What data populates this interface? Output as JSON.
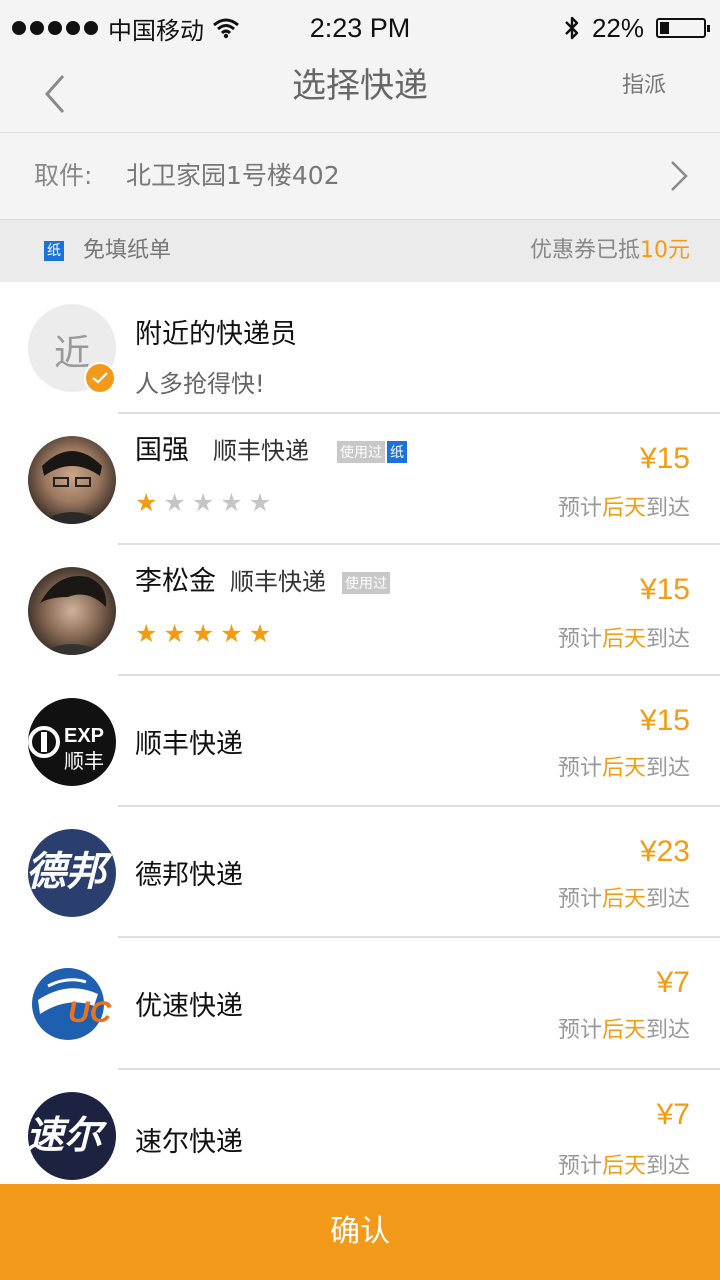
{
  "status_bar": {
    "carrier": "中国移动",
    "time": "2:23 PM",
    "battery": "22%",
    "battery_level": 0.22
  },
  "nav": {
    "back_icon": "chevron-left-icon",
    "title": "选择快递",
    "action": "指派"
  },
  "pickup": {
    "label": "取件:",
    "address": "北卫家园1号楼402"
  },
  "promo": {
    "paper_badge": "纸",
    "free_form": "免填纸单",
    "coupon_prefix": "优惠券已抵",
    "coupon_amount": "10元"
  },
  "nearby": {
    "avatar_text": "近",
    "title": "附近的快递员",
    "subtitle": "人多抢得快!",
    "selected": true
  },
  "couriers": [
    {
      "name": "国强",
      "company": "顺丰快递",
      "used_tag": "使用过",
      "paper_tag": "纸",
      "rating": 1,
      "price": "¥15",
      "eta_prefix": "预计",
      "eta_day": "后天",
      "eta_suffix": "到达"
    },
    {
      "name": "李松金",
      "company": "顺丰快递",
      "used_tag": "使用过",
      "rating": 5,
      "price": "¥15",
      "eta_prefix": "预计",
      "eta_day": "后天",
      "eta_suffix": "到达"
    },
    {
      "name": "顺丰快递",
      "logo_text": "EXP 顺丰",
      "price": "¥15",
      "eta_prefix": "预计",
      "eta_day": "后天",
      "eta_suffix": "到达"
    },
    {
      "name": "德邦快递",
      "logo_text": "德邦",
      "price": "¥23",
      "eta_prefix": "预计",
      "eta_day": "后天",
      "eta_suffix": "到达"
    },
    {
      "name": "优速快递",
      "logo_text": "UC",
      "price": "¥7",
      "eta_prefix": "预计",
      "eta_day": "后天",
      "eta_suffix": "到达"
    },
    {
      "name": "速尔快递",
      "logo_text": "速尔",
      "price": "¥7",
      "eta_prefix": "预计",
      "eta_day": "后天",
      "eta_suffix": "到达"
    }
  ],
  "confirm_label": "确认",
  "colors": {
    "accent": "#f39a1a",
    "badge_blue": "#1a73d9"
  }
}
